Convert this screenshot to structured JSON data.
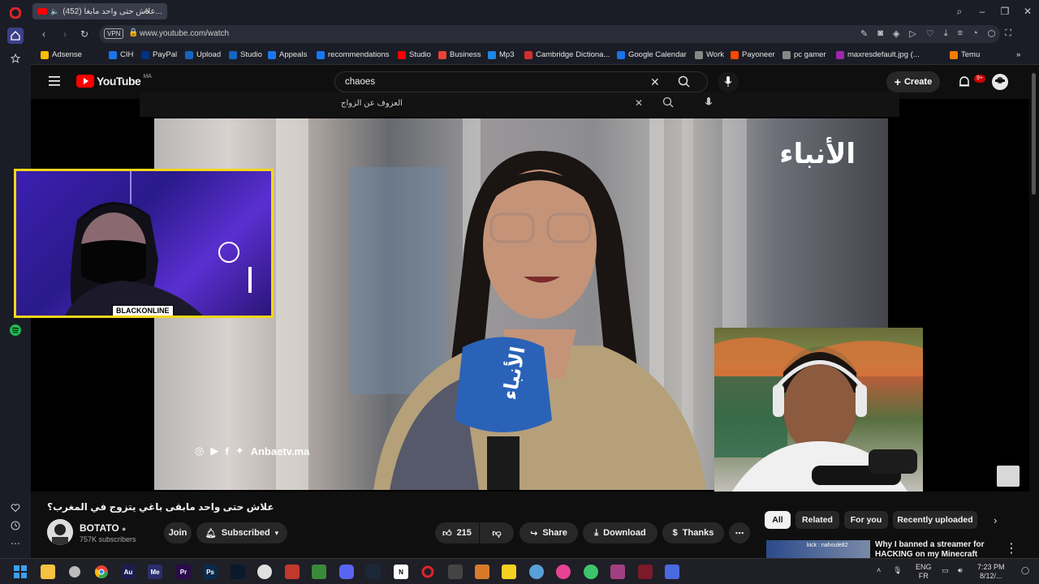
{
  "browser": {
    "tab_title": "(452) علاش حتى واحد مابغا...",
    "url": "www.youtube.com/watch",
    "vpn_label": "VPN"
  },
  "bookmarks": [
    {
      "label": "Adsense",
      "color": "#fbbc04"
    },
    {
      "label": "CIH",
      "color": "#1a73e8"
    },
    {
      "label": "PayPal",
      "color": "#003087"
    },
    {
      "label": "Upload",
      "color": "#1565c0"
    },
    {
      "label": "Studio",
      "color": "#1565c0"
    },
    {
      "label": "Appeals",
      "color": "#1877f2"
    },
    {
      "label": "recommendations",
      "color": "#1877f2"
    },
    {
      "label": "Studio",
      "color": "#ff0000"
    },
    {
      "label": "Business",
      "color": "#ea4335"
    },
    {
      "label": "Mp3",
      "color": "#1e88e5"
    },
    {
      "label": "Cambridge Dictiona...",
      "color": "#d32f2f"
    },
    {
      "label": "Google Calendar",
      "color": "#1a73e8"
    },
    {
      "label": "Work",
      "color": "#888888"
    },
    {
      "label": "Payoneer",
      "color": "#ff4800"
    },
    {
      "label": "pc gamer",
      "color": "#888888"
    },
    {
      "label": "maxresdefault.jpg (...",
      "color": "#9c27b0"
    },
    {
      "label": "Temu",
      "color": "#f57c00"
    }
  ],
  "youtube": {
    "logo_text": "YouTube",
    "region": "MA",
    "search_value": "chaoes",
    "overlay_search_value": "العزوف عن الزواج",
    "create_label": "Create",
    "notif_badge": "9+"
  },
  "video": {
    "watermark": "الأنباء",
    "site_tag": "Anbaetv.ma",
    "mic_text": "الأنباء",
    "title": "علاش حتى واحد مابقى باغي يتزوج في المغرب؟",
    "channel_name": "BOTATO",
    "subscribers": "757K subscribers",
    "join_label": "Join",
    "subscribed_label": "Subscribed",
    "likes": "215",
    "share_label": "Share",
    "download_label": "Download",
    "thanks_label": "Thanks"
  },
  "webcam1": {
    "label": "BLACKONLINE"
  },
  "chips": [
    "All",
    "Related",
    "For you",
    "Recently uploaded"
  ],
  "recommended": {
    "title": "Why I banned a streamer for HACKING on my Minecraft",
    "overlay_text": "kick : nahoule82"
  },
  "taskbar": {
    "lang_top": "ENG",
    "lang_bottom": "FR",
    "time": "7:23 PM",
    "date": "8/12/..."
  },
  "taskbar_apps": [
    {
      "label": "Au",
      "color": "#1b1d4d"
    },
    {
      "label": "Me",
      "color": "#2b2d70"
    },
    {
      "label": "Pr",
      "color": "#2a0a4a"
    },
    {
      "label": "Ps",
      "color": "#0a2a4a"
    }
  ]
}
